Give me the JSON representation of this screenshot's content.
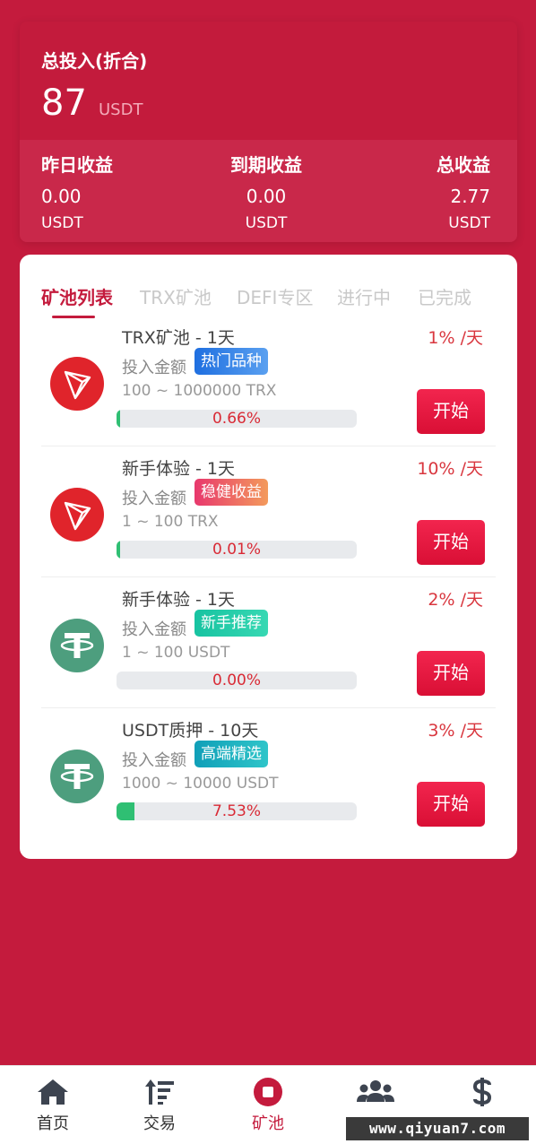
{
  "summary": {
    "title": "总投入(折合)",
    "amount": "87",
    "unit": "USDT",
    "stats": [
      {
        "label": "昨日收益",
        "value": "0.00",
        "unit": "USDT"
      },
      {
        "label": "到期收益",
        "value": "0.00",
        "unit": "USDT"
      },
      {
        "label": "总收益",
        "value": "2.77",
        "unit": "USDT"
      }
    ]
  },
  "tabs": [
    {
      "label": "矿池列表",
      "active": true
    },
    {
      "label": "TRX矿池",
      "active": false
    },
    {
      "label": "DEFI专区",
      "active": false
    },
    {
      "label": "进行中",
      "active": false
    },
    {
      "label": "已完成",
      "active": false
    }
  ],
  "pools": [
    {
      "coin": "trx-icon",
      "name": "TRX矿池 - 1天",
      "rate": "1% /天",
      "invest_label": "投入金额",
      "badge": "热门品种",
      "range": "100 ~ 1000000 TRX",
      "progress_text": "0.66%",
      "progress": 0.0066,
      "button": "开始"
    },
    {
      "coin": "trx-icon",
      "name": "新手体验 - 1天",
      "rate": "10% /天",
      "invest_label": "投入金额",
      "badge": "稳健收益",
      "range": "1 ~ 100 TRX",
      "progress_text": "0.01%",
      "progress": 0.0001,
      "button": "开始"
    },
    {
      "coin": "usdt-icon",
      "name": "新手体验 - 1天",
      "rate": "2% /天",
      "invest_label": "投入金额",
      "badge": "新手推荐",
      "range": "1 ~ 100 USDT",
      "progress_text": "0.00%",
      "progress": 0.0,
      "button": "开始"
    },
    {
      "coin": "usdt-icon",
      "name": "USDT质押 - 10天",
      "rate": "3% /天",
      "invest_label": "投入金额",
      "badge": "高端精选",
      "range": "1000 ~ 10000 USDT",
      "progress_text": "7.53%",
      "progress": 0.0753,
      "button": "开始"
    }
  ],
  "nav": [
    {
      "label": "首页",
      "icon": "home-icon"
    },
    {
      "label": "交易",
      "icon": "sort-icon"
    },
    {
      "label": "矿池",
      "icon": "stop-circle-icon",
      "active": true
    },
    {
      "label": "",
      "icon": "users-icon"
    },
    {
      "label": "",
      "icon": "dollar-icon"
    }
  ],
  "watermark": "www.qiyuan7.com",
  "colors": {
    "brand": "#c41b3d",
    "rate": "#d9373f",
    "progress": "#2fbf73"
  }
}
